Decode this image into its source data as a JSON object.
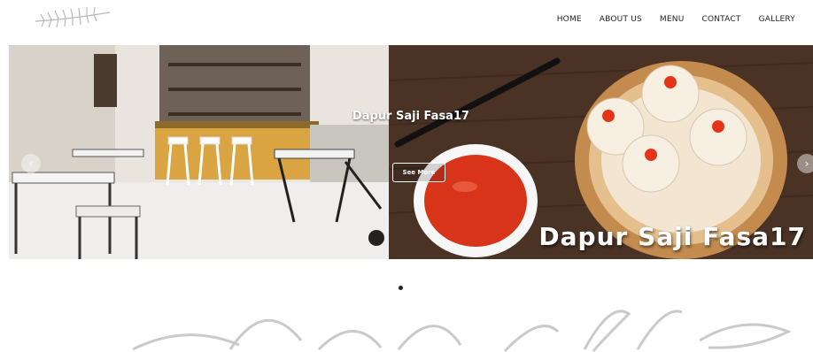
{
  "nav": {
    "items": [
      {
        "label": "HOME"
      },
      {
        "label": "ABOUT US"
      },
      {
        "label": "MENU"
      },
      {
        "label": "CONTACT"
      },
      {
        "label": "GALLERY"
      }
    ]
  },
  "hero": {
    "title": "Dapur Saji Fasa17",
    "button_label": "See More",
    "banner_text": "Dapur Saji Fasa17",
    "prev_icon": "chevron-left-icon",
    "next_icon": "chevron-right-icon"
  },
  "carousel": {
    "active_index": 0,
    "dot_count": 1
  },
  "colors": {
    "nav_text": "#222222",
    "wood": "#4a3325",
    "sauce": "#d8341a",
    "bamboo": "#c48b4f"
  }
}
